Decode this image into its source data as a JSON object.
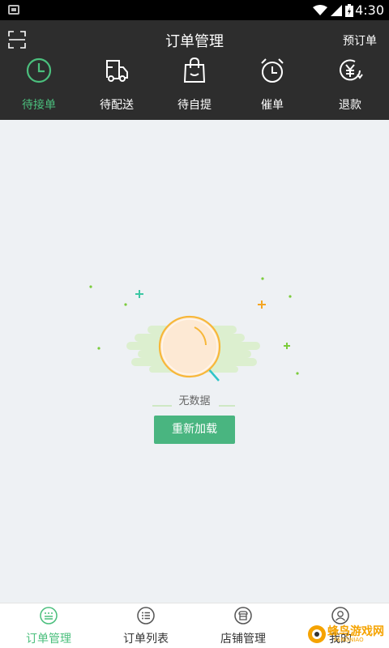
{
  "status_bar": {
    "time": "4:30"
  },
  "header": {
    "title": "订单管理",
    "action_label": "预订单"
  },
  "tabs": [
    {
      "label": "待接单",
      "icon": "clock-icon",
      "active": true
    },
    {
      "label": "待配送",
      "icon": "delivery-truck-icon",
      "active": false
    },
    {
      "label": "待自提",
      "icon": "shopping-bag-icon",
      "active": false
    },
    {
      "label": "催单",
      "icon": "alarm-clock-icon",
      "active": false
    },
    {
      "label": "退款",
      "icon": "yuan-refund-icon",
      "active": false
    }
  ],
  "empty_state": {
    "message": "无数据",
    "reload_label": "重新加载"
  },
  "bottom_nav": [
    {
      "label": "订单管理",
      "icon": "order-manage-icon",
      "active": true
    },
    {
      "label": "订单列表",
      "icon": "list-icon",
      "active": false
    },
    {
      "label": "店铺管理",
      "icon": "store-icon",
      "active": false
    },
    {
      "label": "我的",
      "icon": "user-icon",
      "active": false
    }
  ],
  "watermark": {
    "text": "蜂鸟游戏网",
    "sub": "FENGNIAO"
  },
  "colors": {
    "accent": "#4bbf7d",
    "header_bg": "#2d2d2d",
    "button": "#49b580",
    "page_bg": "#eef1f4"
  }
}
